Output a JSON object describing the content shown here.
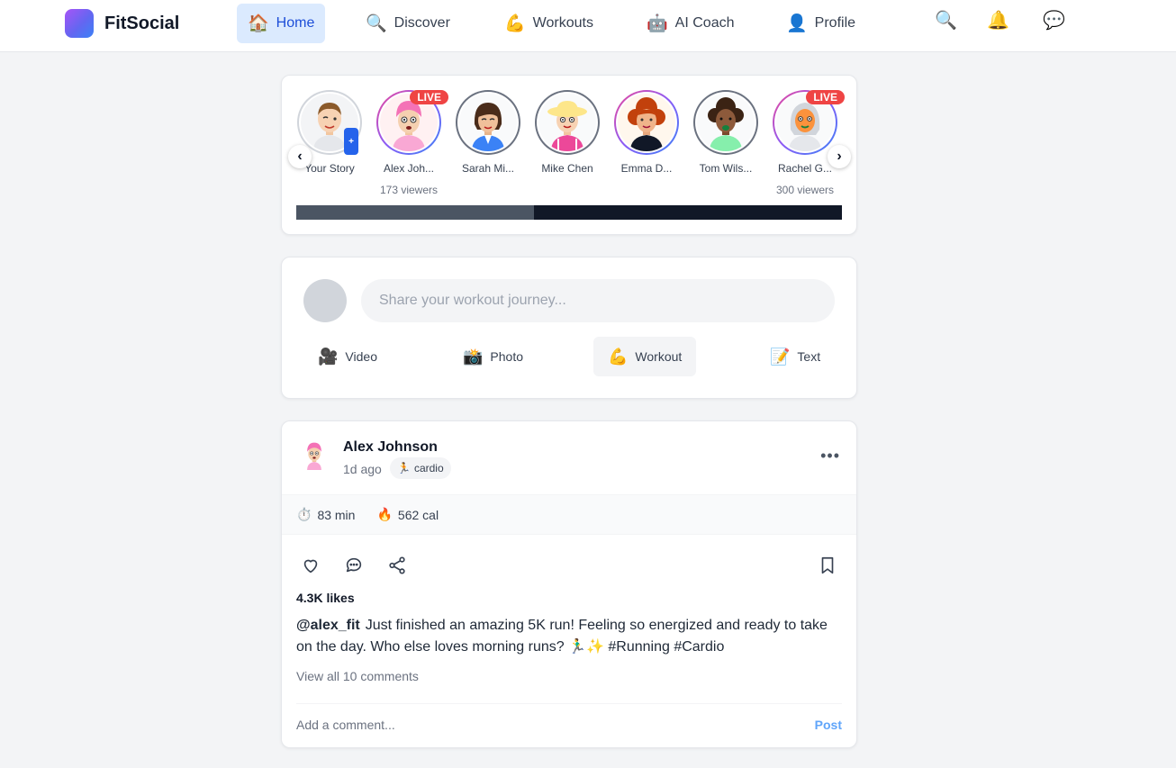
{
  "app": {
    "name": "FitSocial"
  },
  "nav": {
    "items": [
      {
        "label": "Home",
        "emoji": "🏠",
        "icon": "home-icon"
      },
      {
        "label": "Discover",
        "emoji": "🔍",
        "icon": "search-icon"
      },
      {
        "label": "Workouts",
        "emoji": "💪",
        "icon": "muscle-icon"
      },
      {
        "label": "AI Coach",
        "emoji": "🤖",
        "icon": "robot-icon"
      },
      {
        "label": "Profile",
        "emoji": "👤",
        "icon": "user-icon"
      }
    ],
    "right_icons": {
      "search": "🔍",
      "notifications": "🔔",
      "messages": "💬"
    }
  },
  "stories": {
    "live_label": "LIVE",
    "add_label": "+",
    "prev_label": "‹",
    "next_label": "›",
    "scroll_fraction": 0.435,
    "items": [
      {
        "name": "Your Story",
        "sub": ""
      },
      {
        "name": "Alex Joh...",
        "sub": "173 viewers"
      },
      {
        "name": "Sarah Mi...",
        "sub": ""
      },
      {
        "name": "Mike Chen",
        "sub": ""
      },
      {
        "name": "Emma D...",
        "sub": ""
      },
      {
        "name": "Tom Wils...",
        "sub": ""
      },
      {
        "name": "Rachel G...",
        "sub": "300 viewers"
      }
    ]
  },
  "composer": {
    "placeholder": "Share your workout journey...",
    "actions": [
      {
        "label": "Video",
        "emoji": "🎥"
      },
      {
        "label": "Photo",
        "emoji": "📸"
      },
      {
        "label": "Workout",
        "emoji": "💪"
      },
      {
        "label": "Text",
        "emoji": "📝"
      }
    ]
  },
  "post": {
    "author": "Alex Johnson",
    "time": "1d ago",
    "tag": {
      "emoji": "🏃",
      "label": "cardio"
    },
    "more": "•••",
    "stats": [
      {
        "emoji": "⏱️",
        "value": "83 min"
      },
      {
        "emoji": "🔥",
        "value": "562 cal"
      }
    ],
    "likes": "4.3K likes",
    "username": "@alex_fit",
    "caption": "Just finished an amazing 5K run! Feeling so energized and ready to take on the day. Who else loves morning runs? 🏃‍♂️✨ #Running #Cardio",
    "view_comments": "View all 10 comments",
    "comment_placeholder": "Add a comment...",
    "post_button": "Post"
  }
}
